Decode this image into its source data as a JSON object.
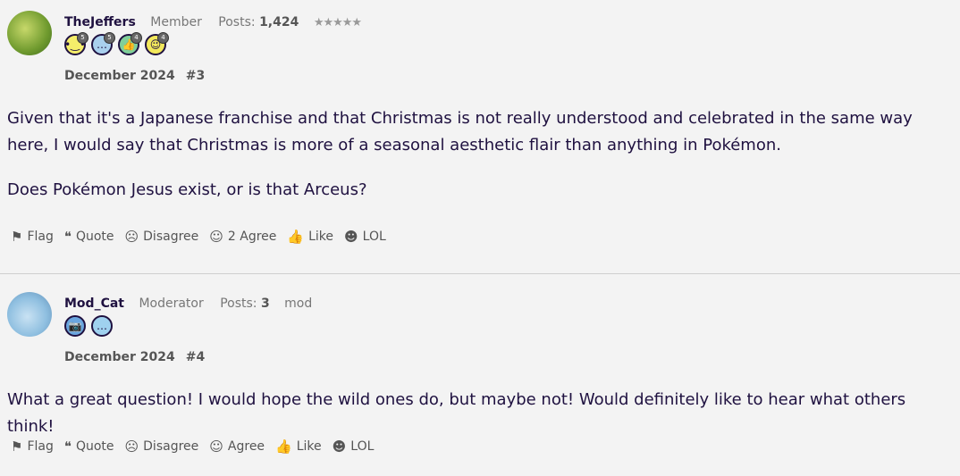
{
  "posts": [
    {
      "username": "TheJeffers",
      "role": "Member",
      "posts_label": "Posts:",
      "posts_count": "1,424",
      "stars": "★★★★★",
      "badges": [
        {
          "icon": "smile-face-icon",
          "glyph": "•‿•",
          "level": "5"
        },
        {
          "icon": "speech-bubble-icon",
          "glyph": "…",
          "level": "5"
        },
        {
          "icon": "thumbs-up-icon",
          "glyph": "👍",
          "level": "4"
        },
        {
          "icon": "wink-face-icon",
          "glyph": "😉",
          "level": "4"
        }
      ],
      "date": "December 2024",
      "number": "#3",
      "paragraphs": [
        "Given that it's a Japanese franchise and that Christmas is not really understood and celebrated in the same way here, I would say that Christmas is more of a seasonal aesthetic flair than anything in Pokémon.",
        "Does Pokémon Jesus exist, or is that Arceus?"
      ],
      "actions": {
        "flag": "Flag",
        "quote": "Quote",
        "disagree": "Disagree",
        "agree": "2 Agree",
        "like": "Like",
        "lol": "LOL"
      }
    },
    {
      "username": "Mod_Cat",
      "role": "Moderator",
      "posts_label": "Posts:",
      "posts_count": "3",
      "tag": "mod",
      "badges": [
        {
          "icon": "camera-icon",
          "glyph": "📷"
        },
        {
          "icon": "speech-bubble-icon",
          "glyph": "…"
        }
      ],
      "date": "December 2024",
      "number": "#4",
      "paragraphs": [
        "What a great question! I would hope the wild ones do, but maybe not! Would definitely like to hear what others think!"
      ],
      "actions": {
        "flag": "Flag",
        "quote": "Quote",
        "disagree": "Disagree",
        "agree": "Agree",
        "like": "Like",
        "lol": "LOL"
      }
    }
  ],
  "icons": {
    "flag": "flag-icon",
    "quote": "quote-icon",
    "disagree": "frown-face-icon",
    "agree": "smile-face-icon",
    "like": "thumbs-up-icon",
    "lol": "laugh-face-icon"
  }
}
